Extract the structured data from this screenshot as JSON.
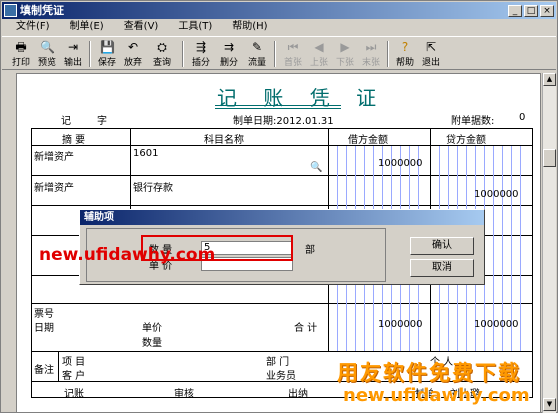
{
  "window": {
    "title": "填制凭证",
    "min": "_",
    "max": "□",
    "close": "×"
  },
  "menu": [
    "文件(F)",
    "制单(E)",
    "查看(V)",
    "工具(T)",
    "帮助(H)"
  ],
  "toolbar": {
    "print": "打印",
    "preview": "预览",
    "export": "输出",
    "save": "保存",
    "discard": "放弃",
    "query": "查询",
    "insert_row": "插分",
    "delete_row": "删分",
    "flow": "流量",
    "first": "首张",
    "prev": "上张",
    "next": "下张",
    "last": "末张",
    "help": "帮助",
    "exit": "退出"
  },
  "voucher": {
    "title": "记 账 凭 证",
    "type_label": "记",
    "word_label": "字",
    "date": "制单日期:2012.01.31",
    "attach_label": "附单据数:",
    "attach_value": "0",
    "col_summary": "摘 要",
    "col_account": "科目名称",
    "col_debit": "借方金额",
    "col_credit": "贷方金额",
    "rows": [
      {
        "summary": "新增资产",
        "account": "1601",
        "debit": "1000000",
        "credit": ""
      },
      {
        "summary": "新增资产",
        "account": "银行存款",
        "debit": "",
        "credit": "1000000"
      }
    ],
    "ticket_no": "票号",
    "date_label": "日期",
    "unit_price": "单价",
    "quantity": "数量",
    "total_label": "合 计",
    "total_debit": "1000000",
    "total_credit": "1000000",
    "remark": "备注",
    "project": "项 目",
    "customer": "客 户",
    "department": "部 门",
    "personal": "个 人",
    "salesperson": "业务员",
    "bookkeeper": "记账",
    "reviewer": "审核",
    "cashier": "出纳",
    "maker": "制单",
    "maker_name": "刘小璐"
  },
  "dialog": {
    "title": "辅助项",
    "qty_label": "数 量",
    "qty_value": "5",
    "qty_unit": "部",
    "price_label": "单 价",
    "price_value": "",
    "ok": "确认",
    "cancel": "取消"
  },
  "watermark": {
    "url_red": "new.ufidawhy.com",
    "brand": "用友软件免费下载",
    "url_orange": "new.ufidawhy.com"
  },
  "colors": {
    "title_blue": "#0a246a",
    "heading_teal": "#006d6d",
    "red_box": "#e00000",
    "watermark_orange": "#ff9900"
  }
}
